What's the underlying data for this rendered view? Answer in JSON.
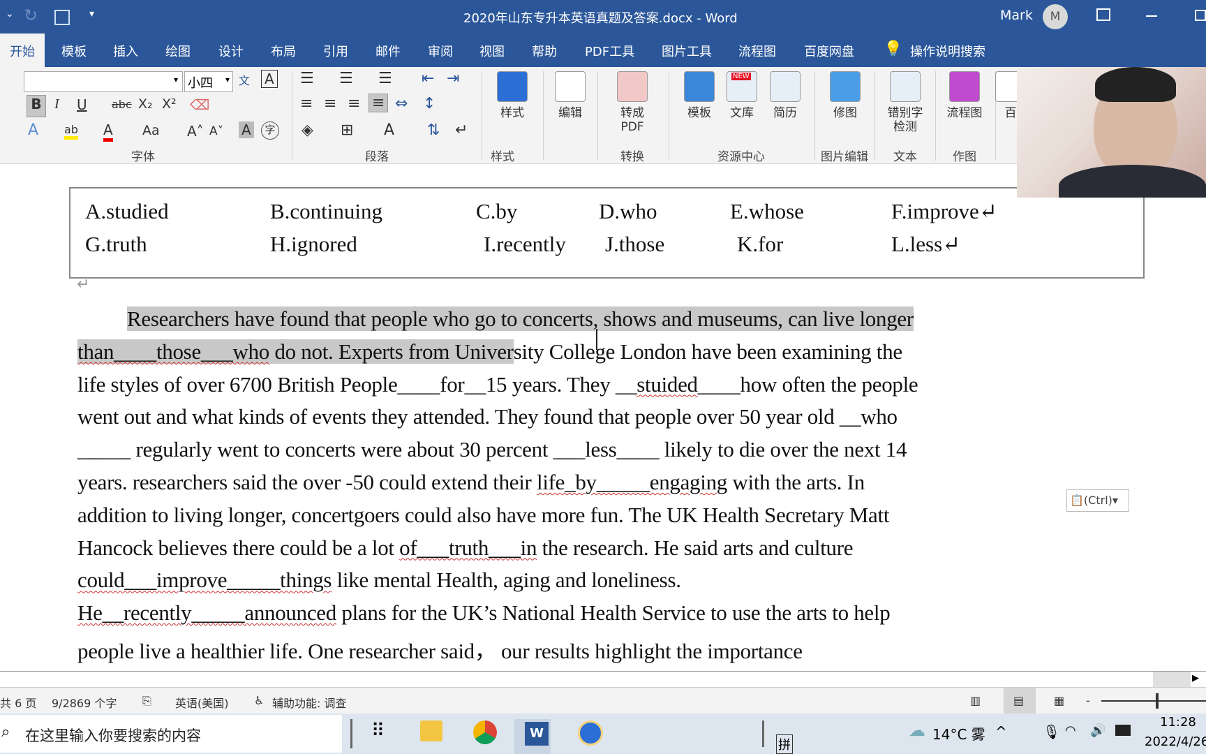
{
  "titlebar": {
    "title": "2020年山东专升本英语真题及答案.docx  -  Word",
    "user": "Mark",
    "avatar": "M"
  },
  "tabs": [
    "开始",
    "模板",
    "插入",
    "绘图",
    "设计",
    "布局",
    "引用",
    "邮件",
    "审阅",
    "视图",
    "帮助",
    "PDF工具",
    "图片工具",
    "流程图",
    "百度网盘"
  ],
  "search_tab": "操作说明搜索",
  "ribbon": {
    "font_size": "小四",
    "font_name": "",
    "groups": [
      "字体",
      "段落",
      "样式",
      "转换",
      "资源中心",
      "图片编辑",
      "文本",
      "作图"
    ],
    "buttons": [
      "样式",
      "编辑",
      "转成PDF",
      "模板",
      "文库",
      "简历",
      "修图",
      "错别字\n检测",
      "流程图",
      "百"
    ],
    "new_badge": "NEW",
    "format_buttons": [
      "B",
      "I",
      "U",
      "abc",
      "X₂",
      "X²",
      "A",
      "Aa",
      "A",
      "A"
    ]
  },
  "word_box": {
    "rows": [
      [
        "A.studied",
        "B.continuing",
        "C.by",
        "D.who",
        "E.whose",
        "F.improve↵"
      ],
      [
        "G.truth",
        "H.ignored",
        "I.recently",
        "J.those",
        "K.for",
        "L.less↵"
      ]
    ]
  },
  "document": {
    "lines": [
      [
        {
          "t": "Researchers have found that people who go to concerts, shows and museums, can live longer",
          "h": 1
        }
      ],
      [
        {
          "t": "than____those___who",
          "h": 1,
          "s": 1
        },
        {
          "t": " do not.    Experts from Univer",
          "h": 1
        },
        {
          "t": "sity College London have been examining the"
        }
      ],
      [
        {
          "t": "life styles of over 6700 British People____for__15 years.    They __"
        },
        {
          "t": "stuided",
          "s": 1
        },
        {
          "t": "____how often the people"
        }
      ],
      [
        {
          "t": "went out and what kinds of events they attended. They found that people over 50 year old __who"
        }
      ],
      [
        {
          "t": "_____ regularly went to concerts were about 30 percent ___less____ likely to die over the next 14"
        }
      ],
      [
        {
          "t": "years.          researchers said the over -50 could extend their "
        },
        {
          "t": "life_by_____engaging",
          "s": 1
        },
        {
          "t": " with the arts. In"
        }
      ],
      [
        {
          "t": "addition to living longer,    concertgoers could also have more fun. The UK Health Secretary Matt"
        }
      ],
      [
        {
          "t": "Hancock believes there could be a lot "
        },
        {
          "t": "of___truth___in",
          "s": 1
        },
        {
          "t": " the research. He said arts and culture"
        }
      ],
      [
        {
          "t": "could___improve_____things",
          "s": 1
        },
        {
          "t": " like mental Health, aging and loneliness."
        }
      ],
      [
        {
          "t": "He__recently_____announced",
          "s": 1
        },
        {
          "t": " plans for the UK’s National Health Service to use the arts to help"
        }
      ],
      [
        {
          "t": "people live a healthier life. One researcher said，   our results highlight the importance"
        }
      ]
    ],
    "paste_options": "(Ctrl)"
  },
  "status": {
    "pages": "共 6 页",
    "words": "9/2869 个字",
    "language": "英语(美国)",
    "accessibility": "辅助功能: 调查"
  },
  "taskbar": {
    "search_placeholder": "在这里输入你要搜索的内容",
    "weather": "14°C 雾",
    "time": "11:28",
    "date": "2022/4/26",
    "ime": "拼"
  },
  "colors": {
    "accent": "#2b579a",
    "highlight": "#c8c8c8",
    "spellcheck": "#d03030"
  }
}
